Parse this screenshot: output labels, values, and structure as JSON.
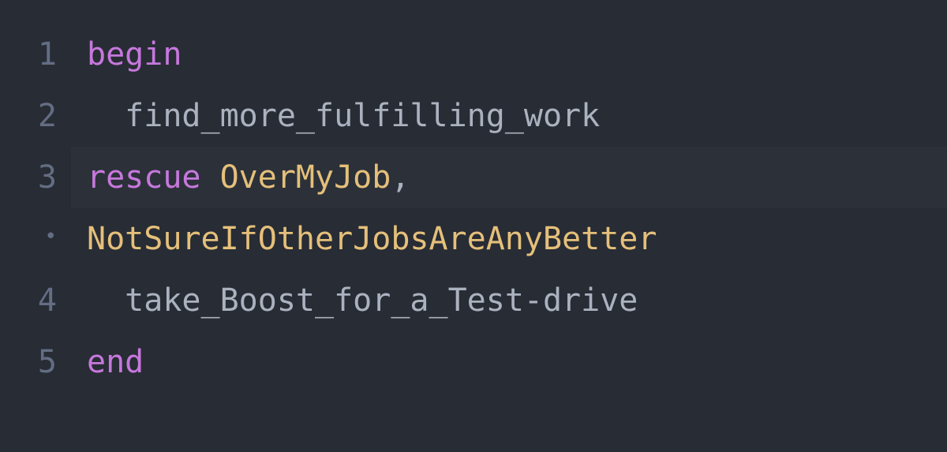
{
  "gutter": {
    "l1": "1",
    "l2": "2",
    "l3": "3",
    "wrap": "•",
    "l4": "4",
    "l5": "5"
  },
  "code": {
    "line1": {
      "keyword": "begin"
    },
    "line2": {
      "indent": "  ",
      "call": "find_more_fulfilling_work"
    },
    "line3": {
      "keyword": "rescue",
      "space": " ",
      "class": "OverMyJob",
      "comma": ","
    },
    "line3wrap": {
      "class": "NotSureIfOtherJobsAreAnyBetter"
    },
    "line4": {
      "indent": "  ",
      "call": "take_Boost_for_a_Test-drive"
    },
    "line5": {
      "keyword": "end"
    }
  }
}
